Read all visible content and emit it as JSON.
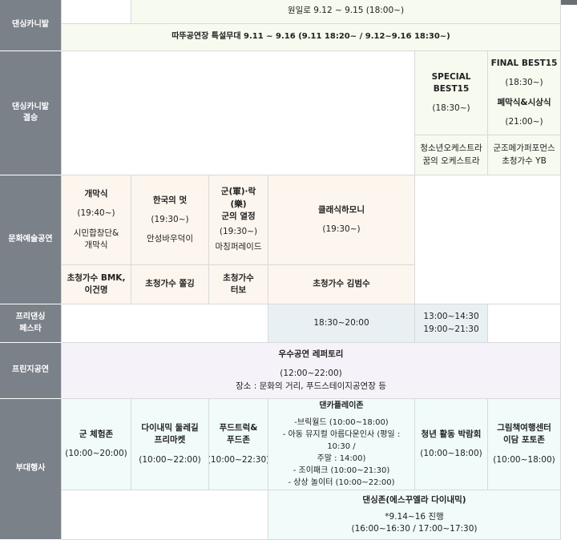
{
  "rows": {
    "carnival": "댄싱카니발",
    "carnival_final": "댄싱카니발\n결승",
    "culture": "문화예술공연",
    "fringe": "프리댄싱\n페스타",
    "fringe_stage": "프린지공연",
    "side": "부대행사"
  },
  "carnival": {
    "top_cut": "원일로 9.12 ~ 9.15 (18:00~)",
    "stage": "따뚜공연장 특설무대 9.11 ~ 9.16 (9.11 18:20~ / 9.12~9.16 18:30~)"
  },
  "final": {
    "special_title": "SPECIAL\nBEST15",
    "special_time": "(18:30~)",
    "final_title": "FINAL BEST15",
    "final_time": "(18:30~)",
    "closing_title": "폐막식&시상식",
    "closing_time": "(21:00~)",
    "special_guest": "청소년오케스트라\n꿈의 오케스트라",
    "final_guest": "군조메가퍼포먼스\n초청가수 YB"
  },
  "culture": {
    "c1_title": "개막식",
    "c1_time": "(19:40~)",
    "c1_desc": "시민합창단&\n개막식",
    "c2_title": "한국의 멋",
    "c2_time": "(19:30~)",
    "c2_desc": "안성바우덕이",
    "c3_title": "군(軍)·락\n(樂)\n군의 열정",
    "c3_time": "(19:30~)",
    "c3_desc": "마칭퍼레이드",
    "c4_title": "클래식하모니",
    "c4_time": "(19:30~)",
    "g1": "초청가수 BMK,\n이건명",
    "g2": "초청가수 쫄깅",
    "g3": "초청가수\n터보",
    "g4": "초청가수 김범수"
  },
  "fringe": {
    "t1": "18:30~20:00",
    "t2": "13:00~14:30\n19:00~21:30"
  },
  "fringe_stage": {
    "title": "우수공연 레퍼토리",
    "time": "(12:00~22:00)",
    "place": "장소 : 문화의 거리, 푸드스테이지공연장 등"
  },
  "side": {
    "e1_title": "군 체험존",
    "e1_time": "(10:00~20:00)",
    "e2_title": "다이내믹 둘레길\n프리마켓",
    "e2_time": "(10:00~22:00)",
    "e3_title": "푸드트럭&\n푸드존",
    "e3_time": "(10:00~22:30)",
    "e4_title": "댄카플레이존",
    "e4_l1": "-브릭월드 (10:00~18:00)",
    "e4_l2": "- 아동 뮤지컬 아름다운인사 (평일 : 10:30 /",
    "e4_l3": "주말 : 14:00)",
    "e4_l4": "- 조이패크 (10:00~21:30)",
    "e4_l5": "- 상상 놀이터 (10:00~22:00)",
    "e5_title": "청년 활동 박람회",
    "e5_time": "(10:00~18:00)",
    "e6_title": "그림책여행센터\n이담 포토존",
    "e6_time": "(10:00~18:00)",
    "dz_title": "댄싱존(에스꾸엘라 다이내믹)",
    "dz_note": "*9.14~16 진행",
    "dz_time": "(16:00~16:30 / 17:00~17:30)"
  }
}
